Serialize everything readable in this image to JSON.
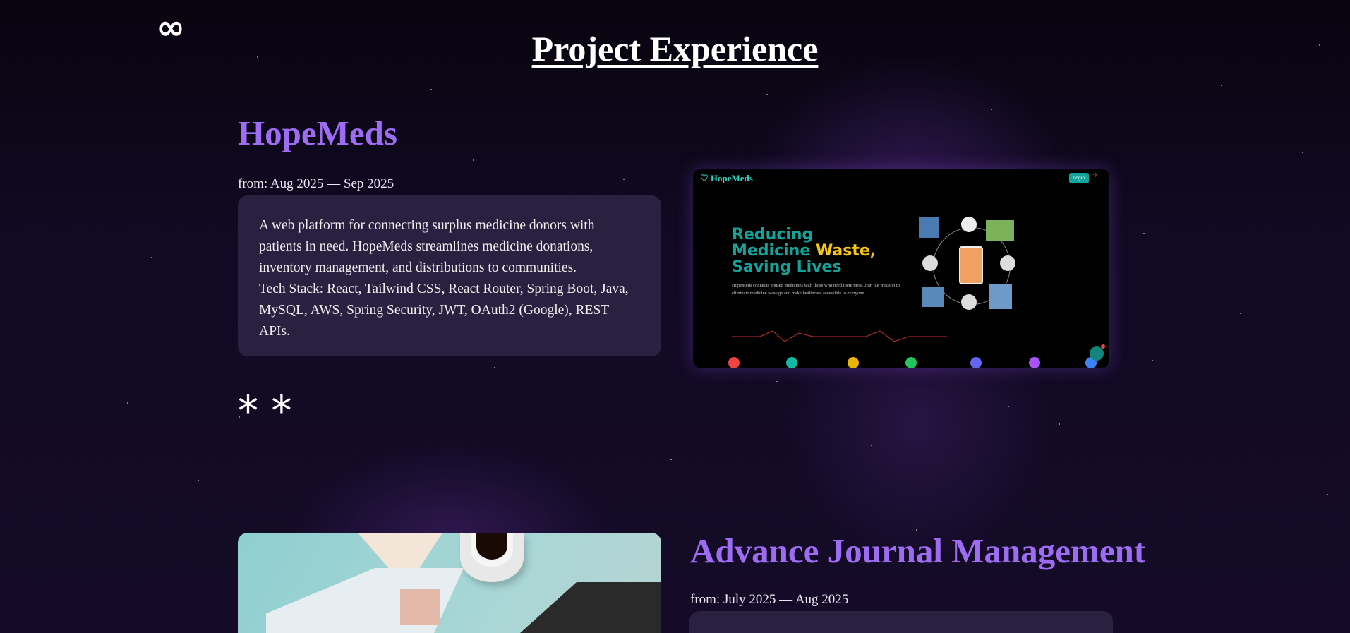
{
  "logo": "∞",
  "page_title": "Project Experience",
  "projects": [
    {
      "title": "HopeMeds",
      "date": "from: Aug 2025 — Sep 2025",
      "description": "A web platform for connecting surplus medicine donors with patients in need. HopeMeds streamlines medicine donations, inventory management, and distributions to communities.",
      "tech": "Tech Stack: React, Tailwind CSS, React Router, Spring Boot, Java, MySQL, AWS, Spring Security, JWT, OAuth2 (Google), REST APIs.",
      "preview": {
        "brand": "HopeMeds",
        "login": "Login",
        "headline1": "Reducing",
        "headline2a": "Medicine ",
        "headline2b": "Waste,",
        "headline3": "Saving Lives",
        "sub": "HopeMeds connects unused medicines with those who need them most. Join our mission to eliminate medicine wastage and make healthcare accessible to everyone.",
        "accent": "#14a39a",
        "highlight": "#f5c518"
      }
    },
    {
      "title": "Advance Journal Management",
      "date": "from: July 2025 — Aug 2025"
    }
  ],
  "divider": "* *"
}
